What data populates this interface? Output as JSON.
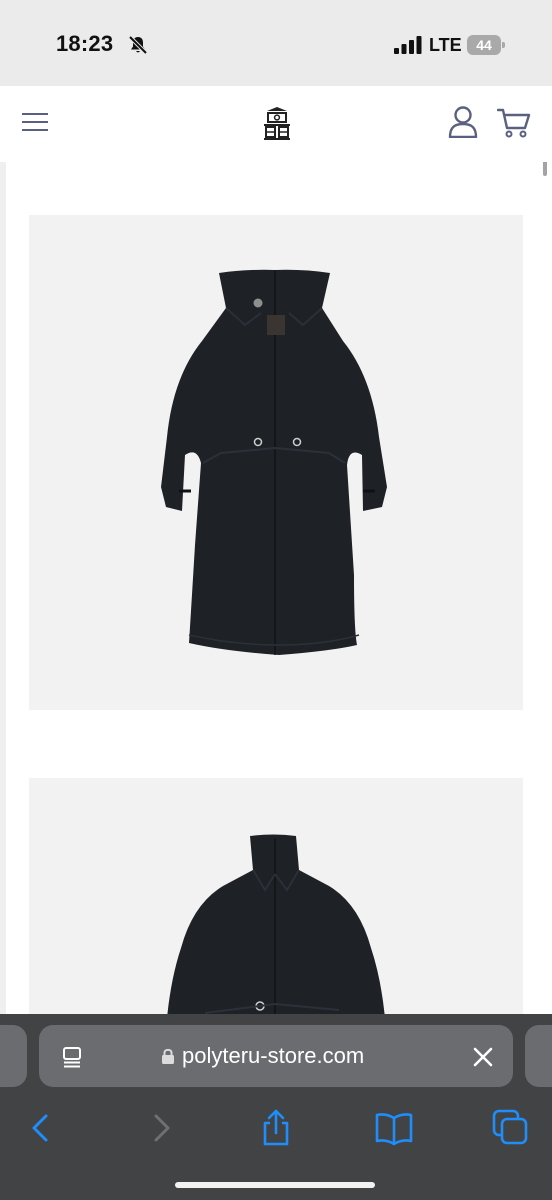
{
  "status_bar": {
    "time": "18:23",
    "network": "LTE",
    "battery": "44",
    "icons": [
      "bell-slash-icon",
      "signal-icon",
      "battery-icon"
    ]
  },
  "header": {
    "icons": [
      "menu-icon",
      "store-logo",
      "account-icon",
      "cart-icon"
    ]
  },
  "products": {
    "images": [
      "long-black-coat-front",
      "black-coat-front-cropped"
    ]
  },
  "browser": {
    "url": "polyteru-store.com",
    "toolbar_icons": [
      "back-icon",
      "forward-icon",
      "share-icon",
      "bookmarks-icon",
      "tabs-icon"
    ]
  },
  "colors": {
    "toolbar_bg": "#424345",
    "address_bar_bg": "#6b6c6f",
    "accent_blue": "#1f8efa",
    "header_icon": "#5a6080",
    "image_bg": "#f2f2f2",
    "coat": "#1e2126"
  }
}
